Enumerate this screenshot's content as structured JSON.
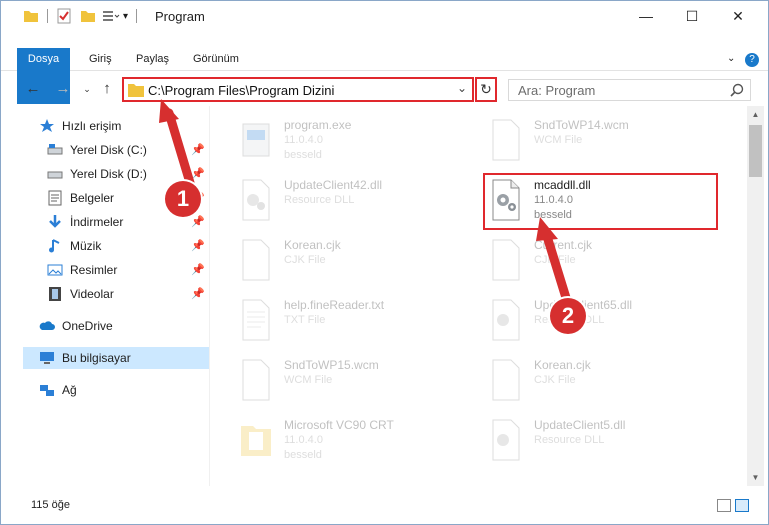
{
  "window": {
    "title": "Program",
    "controls": {
      "minimize": "—",
      "maximize": "☐",
      "close": "✕"
    }
  },
  "ribbon": {
    "tabs": [
      "Dosya",
      "Giriş",
      "Paylaş",
      "Görünüm"
    ],
    "expand_icon": "chevron-down-icon",
    "help_icon": "help-icon"
  },
  "nav": {
    "address_path": "C:\\Program Files\\Program Dizini",
    "search_placeholder": "Ara: Program"
  },
  "sidebar": {
    "items": [
      {
        "label": "Hızlı erişim",
        "icon": "star-icon",
        "pinned": false
      },
      {
        "label": "Yerel Disk (C:)",
        "icon": "drive-icon",
        "pinned": true
      },
      {
        "label": "Yerel Disk (D:)",
        "icon": "drive-icon",
        "pinned": true
      },
      {
        "label": "Belgeler",
        "icon": "document-icon",
        "pinned": true
      },
      {
        "label": "İndirmeler",
        "icon": "download-icon",
        "pinned": true
      },
      {
        "label": "Müzik",
        "icon": "music-icon",
        "pinned": true
      },
      {
        "label": "Resimler",
        "icon": "pictures-icon",
        "pinned": true
      },
      {
        "label": "Videolar",
        "icon": "video-icon",
        "pinned": true
      },
      {
        "label": "OneDrive",
        "icon": "cloud-icon",
        "pinned": false
      },
      {
        "label": "Bu bilgisayar",
        "icon": "computer-icon",
        "pinned": false
      },
      {
        "label": "Ağ",
        "icon": "network-icon",
        "pinned": false
      }
    ]
  },
  "files": [
    {
      "name": "program.exe",
      "line1": "11.0.4.0",
      "line2": "besseld",
      "type": "exe"
    },
    {
      "name": "SndToWP14.wcm",
      "line1": "WCM File",
      "line2": "",
      "type": "blank"
    },
    {
      "name": "UpdateClient42.dll",
      "line1": "Resource DLL",
      "line2": "",
      "type": "dll"
    },
    {
      "name": "mcaddll.dll",
      "line1": "11.0.4.0",
      "line2": "besseld",
      "type": "dll"
    },
    {
      "name": "Korean.cjk",
      "line1": "CJK File",
      "line2": "",
      "type": "blank"
    },
    {
      "name": "Current.cjk",
      "line1": "CJK File",
      "line2": "",
      "type": "blank"
    },
    {
      "name": "help.fineReader.txt",
      "line1": "TXT File",
      "line2": "",
      "type": "txt"
    },
    {
      "name": "UpdateClient65.dll",
      "line1": "Resource DLL",
      "line2": "",
      "type": "dll"
    },
    {
      "name": "SndToWP15.wcm",
      "line1": "WCM File",
      "line2": "",
      "type": "blank"
    },
    {
      "name": "Korean.cjk",
      "line1": "CJK File",
      "line2": "",
      "type": "blank"
    },
    {
      "name": "Microsoft VC90 CRT",
      "line1": "11.0.4.0",
      "line2": "besseld",
      "type": "folder"
    },
    {
      "name": "UpdateClient5.dll",
      "line1": "Resource DLL",
      "line2": "",
      "type": "dll"
    }
  ],
  "status": {
    "item_count": "115 öğe"
  },
  "annotations": {
    "step1": "1",
    "step2": "2"
  },
  "colors": {
    "accent": "#1979ca",
    "highlight": "#e0282d",
    "selected": "#cce8ff"
  }
}
